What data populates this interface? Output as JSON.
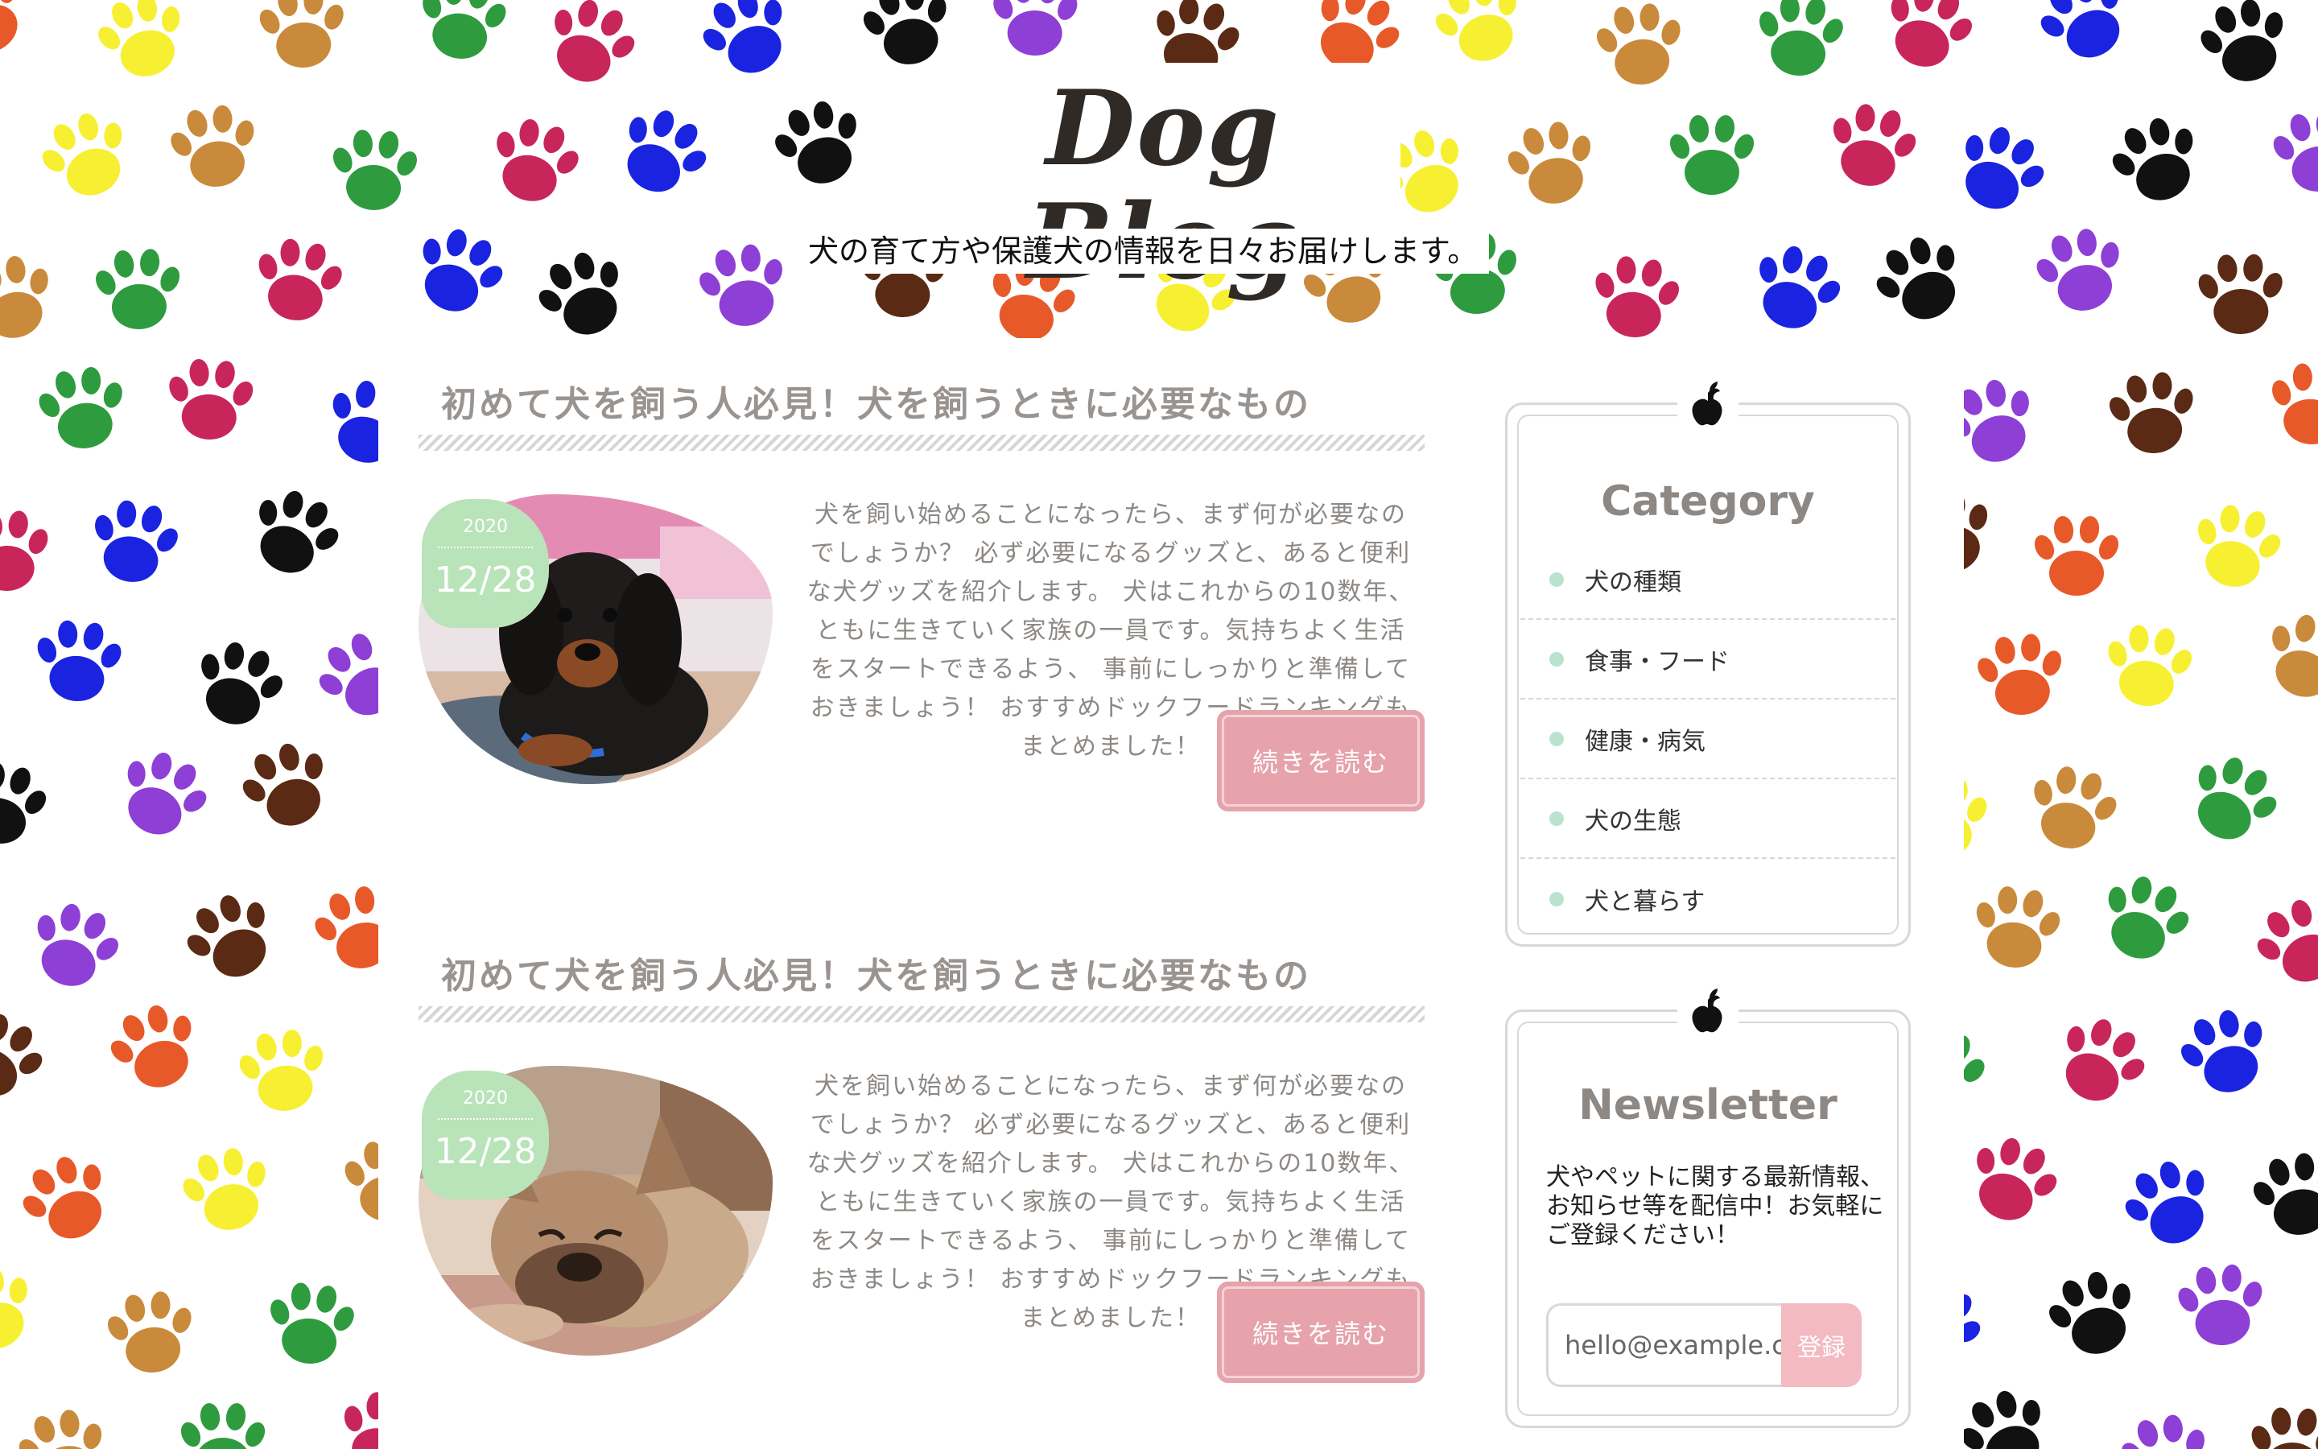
{
  "header": {
    "site_title": "Dog Blog",
    "tagline": "犬の育て方や保護犬の情報を日々お届けします。"
  },
  "posts": [
    {
      "title": "初めて犬を飼う人必見！犬を飼うときに必要なもの",
      "date_year": "2020",
      "date_md": "12/28",
      "excerpt": "犬を飼い始めることになったら、まず何が必要なのでしょうか？ 必ず必要になるグッズと、あると便利な犬グッズを紹介します。 犬はこれからの10数年、ともに生きていく家族の一員です。気持ちよく生活をスタートできるよう、 事前にしっかりと準備しておきましょう！ おすすめドックフードランキングもまとめました！",
      "read_more": "続きを読む",
      "image": "dachshund-puppy-photo"
    },
    {
      "title": "初めて犬を飼う人必見！犬を飼うときに必要なもの",
      "date_year": "2020",
      "date_md": "12/28",
      "excerpt": "犬を飼い始めることになったら、まず何が必要なのでしょうか？ 必ず必要になるグッズと、あると便利な犬グッズを紹介します。 犬はこれからの10数年、ともに生きていく家族の一員です。気持ちよく生活をスタートできるよう、 事前にしっかりと準備しておきましょう！ おすすめドックフードランキングもまとめました！",
      "read_more": "続きを読む",
      "image": "french-bulldog-photo"
    }
  ],
  "sidebar": {
    "category": {
      "icon": "apple-icon",
      "title": "Category",
      "items": [
        "犬の種類",
        "食事・フード",
        "健康・病気",
        "犬の生態",
        "犬と暮らす"
      ]
    },
    "newsletter": {
      "icon": "apple-icon",
      "title": "Newsletter",
      "text": "犬やペットに関する最新情報、お知らせ等を配信中！お気軽にご登録ください！",
      "input_value": "hello@example.com",
      "button": "登録"
    }
  },
  "colors": {
    "date_badge": "#b9e3b8",
    "read_more": "#e6a3ab",
    "subscribe": "#f3bac2",
    "category_dot": "#b9e3cf",
    "paw_palette": [
      "#e8592a",
      "#8e3fd6",
      "#1a23e0",
      "#2f9b3f",
      "#f7f032",
      "#5a2a14",
      "#111111",
      "#c8265a",
      "#c98a3c"
    ]
  }
}
